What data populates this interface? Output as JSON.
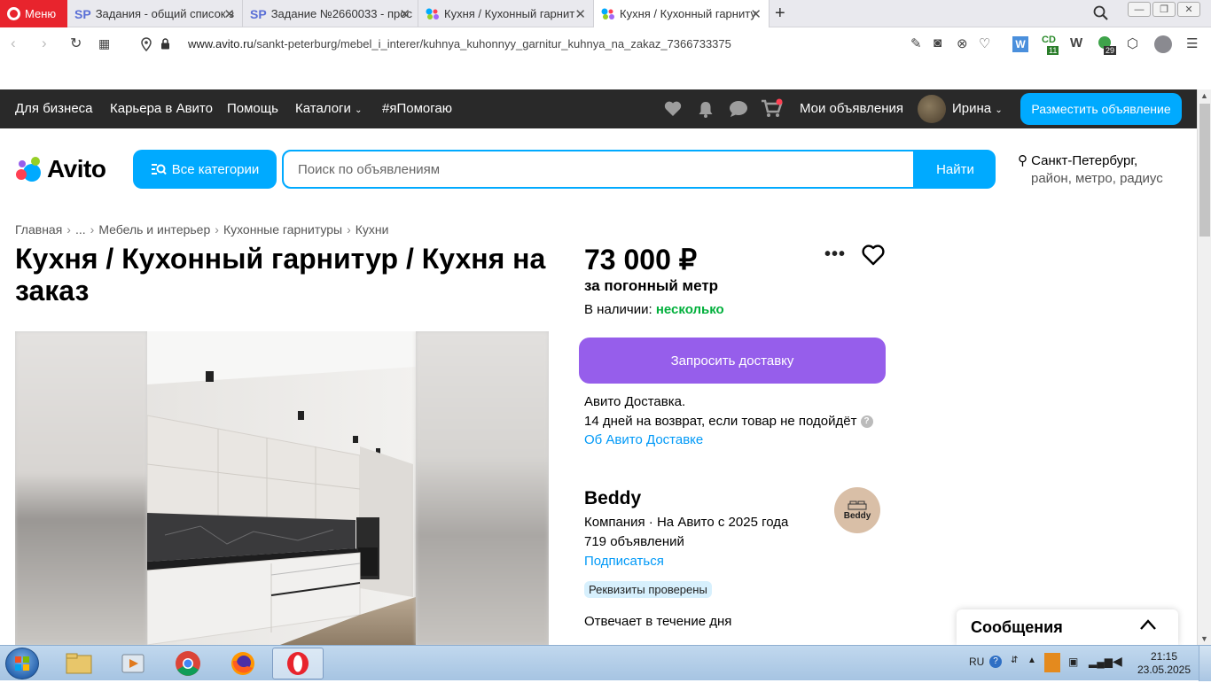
{
  "browser": {
    "menu_label": "Меню",
    "tabs": [
      {
        "label": "Задания - общий список з",
        "favicon": "SP"
      },
      {
        "label": "Задание №2660033 - прос",
        "favicon": "SP"
      },
      {
        "label": "Кухня / Кухонный гарнит",
        "favicon": "avito-dots"
      },
      {
        "label": "Кухня / Кухонный гарниту",
        "favicon": "avito-dots"
      }
    ],
    "url_host": "www.avito.ru",
    "url_path": "/sankt-peterburg/mebel_i_interer/kuhnya_kuhonnyy_garnitur_kuhnya_na_zakaz_7366733375",
    "ext_badge_1": "11",
    "ext_badge_2": "29"
  },
  "topnav": {
    "items": [
      "Для бизнеса",
      "Карьера в Авито",
      "Помощь",
      "Каталоги",
      "#яПомогаю"
    ],
    "my_ads": "Мои объявления",
    "user_name": "Ирина",
    "post_button": "Разместить объявление"
  },
  "search": {
    "logo_text": "Avito",
    "categories_button": "Все категории",
    "placeholder": "Поиск по объявлениям",
    "find_button": "Найти",
    "location_city": "Санкт-Петербург,",
    "location_sub": "район, метро, радиус"
  },
  "breadcrumbs": [
    "Главная",
    "...",
    "Мебель и интерьер",
    "Кухонные гарнитуры",
    "Кухни"
  ],
  "listing": {
    "title": "Кухня / Кухонный гарнитур / Кухня на заказ",
    "price": "73 000 ₽",
    "price_unit": "за погонный метр",
    "availability_label": "В наличии:",
    "availability_value": "несколько",
    "delivery_button": "Запросить доставку",
    "delivery_name": "Авито Доставка.",
    "return_text": "14 дней на возврат, если товар не подойдёт",
    "delivery_link": "Об Авито Доставке"
  },
  "seller": {
    "name": "Beddy",
    "meta": "Компания · На Авито с 2025 года",
    "ads_count": "719 объявлений",
    "subscribe": "Подписаться",
    "verified_badge": "Реквизиты проверены",
    "response_time": "Отвечает в течение дня",
    "logo_text": "Beddy"
  },
  "messages_popup": {
    "title": "Сообщения"
  },
  "taskbar": {
    "lang": "RU",
    "time": "21:15",
    "date": "23.05.2025"
  },
  "colors": {
    "avito_blue": "#00aaff",
    "delivery_purple": "#965eeb",
    "available_green": "#02b03c",
    "opera_red": "#e8242d",
    "dark_nav": "#292929"
  }
}
